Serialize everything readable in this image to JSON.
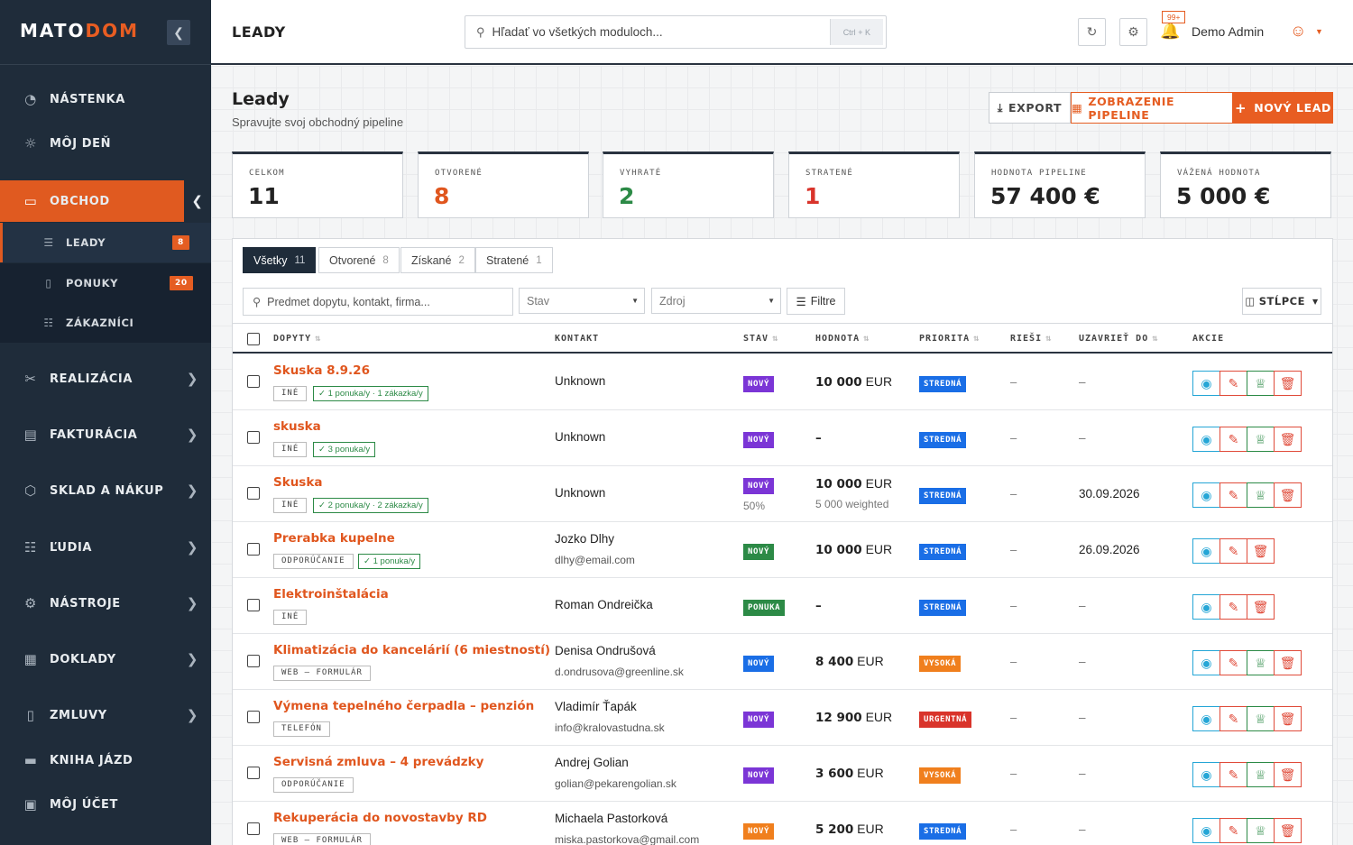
{
  "app": {
    "logo_a": "MATO",
    "logo_b": "DOM"
  },
  "sidebar": {
    "items": [
      {
        "label": "NÁSTENKA",
        "icon": "gauge-icon"
      },
      {
        "label": "MÔJ DEŇ",
        "icon": "sun-icon"
      },
      {
        "label": "OBCHOD",
        "icon": "briefcase-icon"
      },
      {
        "label": "REALIZÁCIA",
        "icon": "tools-icon"
      },
      {
        "label": "FAKTURÁCIA",
        "icon": "invoice-icon"
      },
      {
        "label": "SKLAD A NÁKUP",
        "icon": "box-icon"
      },
      {
        "label": "ĽUDIA",
        "icon": "people-icon"
      },
      {
        "label": "NÁSTROJE",
        "icon": "gear-icon"
      },
      {
        "label": "DOKLADY",
        "icon": "receipt-icon"
      },
      {
        "label": "ZMLUVY",
        "icon": "contract-icon"
      },
      {
        "label": "KNIHA JÁZD",
        "icon": "car-icon"
      },
      {
        "label": "MÔJ ÚČET",
        "icon": "id-card-icon"
      }
    ],
    "subitems": [
      {
        "label": "LEADY",
        "badge": "8"
      },
      {
        "label": "PONUKY",
        "badge": "20"
      },
      {
        "label": "ZÁKAZNÍCI",
        "badge": ""
      }
    ]
  },
  "topbar": {
    "title": "LEADY",
    "search_placeholder": "Hľadať vo všetkých moduloch...",
    "kbd_ctrl": "Ctrl",
    "kbd_plus": "+",
    "kbd_key": "K",
    "notif_badge": "99+",
    "user_name": "Demo Admin"
  },
  "page": {
    "title": "Leady",
    "subtitle": "Spravujte svoj obchodný pipeline",
    "btn_export": "EXPORT",
    "btn_pipeline": "ZOBRAZENIE PIPELINE",
    "btn_new": "NOVÝ LEAD"
  },
  "stats": [
    {
      "label": "CELKOM",
      "value": "11",
      "color": "#222222"
    },
    {
      "label": "OTVORENÉ",
      "value": "8",
      "color": "#e0561e"
    },
    {
      "label": "VYHRATÉ",
      "value": "2",
      "color": "#2c8a46"
    },
    {
      "label": "STRATENÉ",
      "value": "1",
      "color": "#d9342b"
    },
    {
      "label": "HODNOTA PIPELINE",
      "value": "57 400 €",
      "color": "#222222"
    },
    {
      "label": "VÁŽENÁ HODNOTA",
      "value": "5 000 €",
      "color": "#222222"
    }
  ],
  "tabs": [
    {
      "label": "Všetky",
      "count": "11"
    },
    {
      "label": "Otvorené",
      "count": "8"
    },
    {
      "label": "Získané",
      "count": "2"
    },
    {
      "label": "Stratené",
      "count": "1"
    }
  ],
  "filters": {
    "search_placeholder": "Predmet dopytu, kontakt, firma...",
    "status_placeholder": "Stav",
    "source_placeholder": "Zdroj",
    "filter_label": "Filtre",
    "columns_label": "STĹPCE"
  },
  "table": {
    "headers": {
      "subject": "DOPYTY",
      "contact": "KONTAKT",
      "status": "STAV",
      "value": "HODNOTA",
      "priority": "PRIORITA",
      "owner": "RIEŠI",
      "close": "UZAVRIEŤ DO",
      "actions": "AKCIE"
    },
    "rows": [
      {
        "title": "Skuska 8.9.26",
        "source": "INÉ",
        "offers": "1 ponuka/y · 1 zákazka/y",
        "name": "Unknown",
        "email": "",
        "status": "NOVÝ",
        "status_color": "#7b35d6",
        "prob": "",
        "value_num": "10 000",
        "value_cur": "EUR",
        "weighted": "",
        "priority": "STREDNÁ",
        "priority_color": "#1a6ee6",
        "owner": "–",
        "date": "–",
        "win": true
      },
      {
        "title": "skuska",
        "source": "INÉ",
        "offers": "3 ponuka/y",
        "name": "Unknown",
        "email": "",
        "status": "NOVÝ",
        "status_color": "#7b35d6",
        "prob": "",
        "value_num": "–",
        "value_cur": "",
        "weighted": "",
        "priority": "STREDNÁ",
        "priority_color": "#1a6ee6",
        "owner": "–",
        "date": "–",
        "win": true
      },
      {
        "title": "Skuska",
        "source": "INÉ",
        "offers": "2 ponuka/y · 2 zákazka/y",
        "name": "Unknown",
        "email": "",
        "status": "NOVÝ",
        "status_color": "#7b35d6",
        "prob": "50%",
        "value_num": "10 000",
        "value_cur": "EUR",
        "weighted": "5 000 weighted",
        "priority": "STREDNÁ",
        "priority_color": "#1a6ee6",
        "owner": "–",
        "date": "30.09.2026",
        "win": true
      },
      {
        "title": "Prerabka kupelne",
        "source": "ODPORÚČANIE",
        "offers": "1 ponuka/y",
        "name": "Jozko Dlhy",
        "email": "dlhy@email.com",
        "status": "NOVÝ",
        "status_color": "#2c8a46",
        "prob": "",
        "value_num": "10 000",
        "value_cur": "EUR",
        "weighted": "",
        "priority": "STREDNÁ",
        "priority_color": "#1a6ee6",
        "owner": "–",
        "date": "26.09.2026",
        "win": false
      },
      {
        "title": "Elektroinštalácia",
        "source": "INÉ",
        "offers": "",
        "name": "Roman Ondreička",
        "email": "",
        "status": "PONUKA",
        "status_color": "#2c8a46",
        "prob": "",
        "value_num": "–",
        "value_cur": "",
        "weighted": "",
        "priority": "STREDNÁ",
        "priority_color": "#1a6ee6",
        "owner": "–",
        "date": "–",
        "win": false
      },
      {
        "title": "Klimatizácia do kancelárií (6 miestností)",
        "source": "WEB – FORMULÁR",
        "offers": "",
        "name": "Denisa Ondrušová",
        "email": "d.ondrusova@greenline.sk",
        "status": "NOVÝ",
        "status_color": "#1a6ee6",
        "prob": "",
        "value_num": "8 400",
        "value_cur": "EUR",
        "weighted": "",
        "priority": "VYSOKÁ",
        "priority_color": "#f07f1d",
        "owner": "–",
        "date": "–",
        "win": true
      },
      {
        "title": "Výmena tepelného čerpadla – penzión",
        "source": "TELEFÓN",
        "offers": "",
        "name": "Vladimír Ťapák",
        "email": "info@kralovastudna.sk",
        "status": "NOVÝ",
        "status_color": "#7b35d6",
        "prob": "",
        "value_num": "12 900",
        "value_cur": "EUR",
        "weighted": "",
        "priority": "URGENTNÁ",
        "priority_color": "#d9342b",
        "owner": "–",
        "date": "–",
        "win": true
      },
      {
        "title": "Servisná zmluva – 4 prevádzky",
        "source": "ODPORÚČANIE",
        "offers": "",
        "name": "Andrej Golian",
        "email": "golian@pekarengolian.sk",
        "status": "NOVÝ",
        "status_color": "#7b35d6",
        "prob": "",
        "value_num": "3 600",
        "value_cur": "EUR",
        "weighted": "",
        "priority": "VYSOKÁ",
        "priority_color": "#f07f1d",
        "owner": "–",
        "date": "–",
        "win": true
      },
      {
        "title": "Rekuperácia do novostavby RD",
        "source": "WEB – FORMULÁR",
        "offers": "",
        "name": "Michaela Pastorková",
        "email": "miska.pastorkova@gmail.com",
        "status": "NOVÝ",
        "status_color": "#f07f1d",
        "prob": "",
        "value_num": "5 200",
        "value_cur": "EUR",
        "weighted": "",
        "priority": "STREDNÁ",
        "priority_color": "#1a6ee6",
        "owner": "–",
        "date": "–",
        "win": true
      }
    ]
  }
}
